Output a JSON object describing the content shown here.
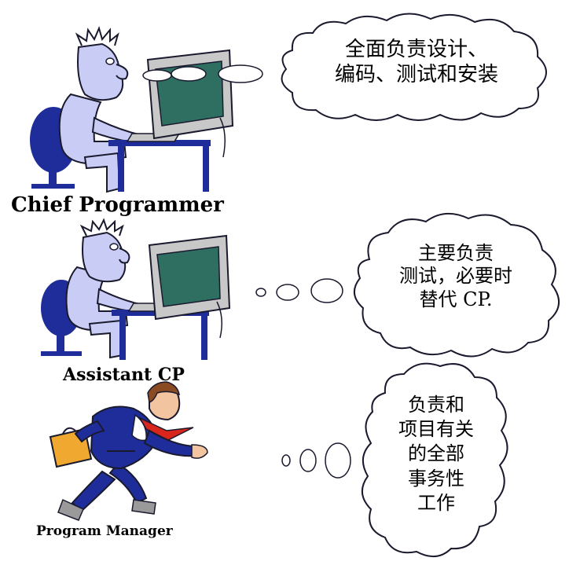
{
  "roles": {
    "chief": {
      "label": "Chief Programmer",
      "bubble": [
        "全面负责设计、",
        "编码、测试和安装"
      ]
    },
    "assistant": {
      "label": "Assistant CP",
      "bubble": [
        "主要负责",
        "测试，必要时",
        "替代 CP."
      ]
    },
    "manager": {
      "label": "Program Manager",
      "bubble": [
        "负责和",
        "项目有关",
        "的全部",
        "事务性",
        "工作"
      ]
    }
  },
  "colors": {
    "figure": "#c9cdf5",
    "figure_outline": "#1a1a2e",
    "chair": "#1f2d9a",
    "monitor_body": "#c8c8c8",
    "screen": "#2f6f62",
    "manager_suit": "#1f2d9a",
    "briefcase": "#f0a830",
    "tie": "#d9261c"
  }
}
